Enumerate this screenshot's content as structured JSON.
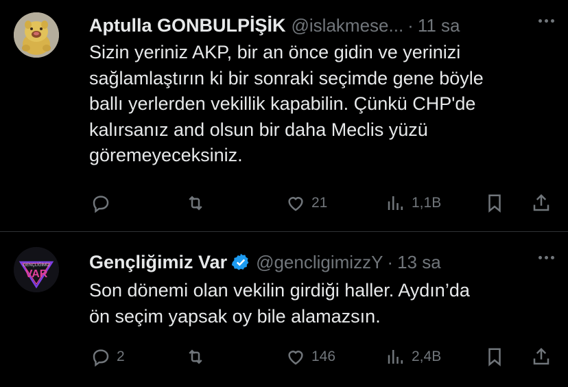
{
  "tweets": [
    {
      "display_name": "Aptulla GONBULPİŞİK",
      "handle": "@islakmese...",
      "separator": "·",
      "time": "11 sa",
      "verified": false,
      "text_lines": [
        "Sizin yeriniz AKP, bir an önce gidin ve yerinizi",
        "sağlamlaştırın ki bir sonraki seçimde gene böyle",
        "ballı yerlerden vekillik kapabilin. Çünkü CHP'de",
        "kalırsanız and olsun bir daha Meclis yüzü",
        "göremeyeceksiniz."
      ],
      "replies": "",
      "retweets": "",
      "likes": "21",
      "views": "1,1B",
      "avatar_icon": "plush-toy-avatar"
    },
    {
      "display_name": "Gençliğimiz Var",
      "handle": "@gencligimizzY",
      "separator": "·",
      "time": "13 sa",
      "verified": true,
      "text_lines": [
        "Son dönemi olan vekilin girdiği haller. Aydın’da",
        "ön seçim yapsak oy bile alamazsın."
      ],
      "replies": "2",
      "retweets": "",
      "likes": "146",
      "views": "2,4B",
      "avatar_icon": "var-logo-avatar"
    }
  ],
  "colors": {
    "background": "#000000",
    "text": "#e7e9ea",
    "muted": "#71767b",
    "divider": "#2f3336",
    "verified": "#1d9bf0"
  }
}
